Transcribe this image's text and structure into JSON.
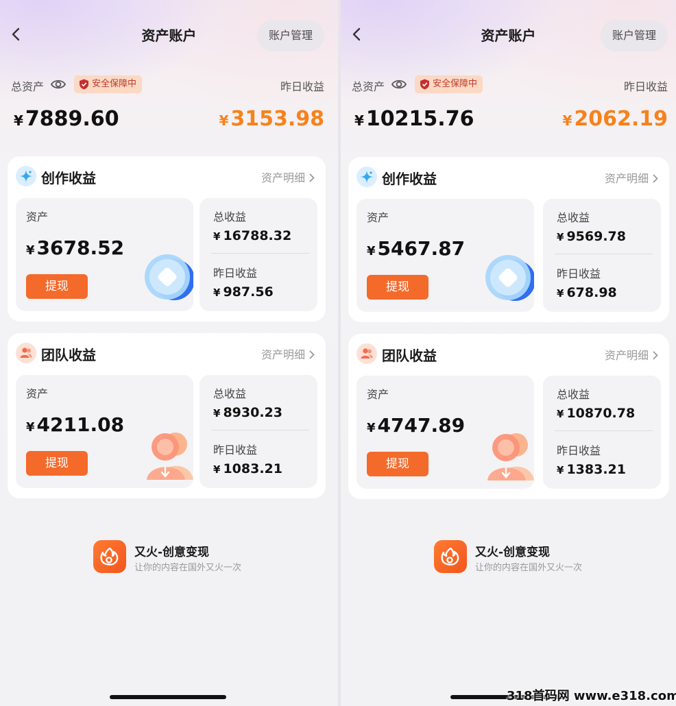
{
  "screens": [
    {
      "nav": {
        "title": "资产账户",
        "manage_label": "账户管理"
      },
      "summary": {
        "total_label": "总资产",
        "safe_badge": "安全保障中",
        "yesterday_label": "昨日收益",
        "currency": "¥",
        "total_amount": "7889.60",
        "yesterday_amount": "3153.98"
      },
      "cards": [
        {
          "title": "创作收益",
          "detail_link": "资产明细",
          "asset_label": "资产",
          "asset_amount": "3678.52",
          "withdraw_label": "提现",
          "total_income_label": "总收益",
          "total_income": "16788.32",
          "yesterday_income_label": "昨日收益",
          "yesterday_income": "987.56"
        },
        {
          "title": "团队收益",
          "detail_link": "资产明细",
          "asset_label": "资产",
          "asset_amount": "4211.08",
          "withdraw_label": "提现",
          "total_income_label": "总收益",
          "total_income": "8930.23",
          "yesterday_income_label": "昨日收益",
          "yesterday_income": "1083.21"
        }
      ],
      "brand": {
        "name": "又火-创意变现",
        "slogan": "让你的内容在国外又火一次"
      }
    },
    {
      "nav": {
        "title": "资产账户",
        "manage_label": "账户管理"
      },
      "summary": {
        "total_label": "总资产",
        "safe_badge": "安全保障中",
        "yesterday_label": "昨日收益",
        "currency": "¥",
        "total_amount": "10215.76",
        "yesterday_amount": "2062.19"
      },
      "cards": [
        {
          "title": "创作收益",
          "detail_link": "资产明细",
          "asset_label": "资产",
          "asset_amount": "5467.87",
          "withdraw_label": "提现",
          "total_income_label": "总收益",
          "total_income": "9569.78",
          "yesterday_income_label": "昨日收益",
          "yesterday_income": "678.98"
        },
        {
          "title": "团队收益",
          "detail_link": "资产明细",
          "asset_label": "资产",
          "asset_amount": "4747.89",
          "withdraw_label": "提现",
          "total_income_label": "总收益",
          "total_income": "10870.78",
          "yesterday_income_label": "昨日收益",
          "yesterday_income": "1383.21"
        }
      ],
      "brand": {
        "name": "又火-创意变现",
        "slogan": "让你的内容在国外又火一次"
      }
    }
  ],
  "watermark": "318首码网 www.e318.com",
  "icons": {
    "back": "chevron-left-icon",
    "eye": "eye-icon",
    "shield": "shield-icon",
    "sparkle": "sparkle-icon",
    "team": "team-icon",
    "chevron": "chevron-right-icon",
    "logo": "brand-logo-icon"
  },
  "colors": {
    "accent_orange": "#f7821b",
    "button_orange": "#f46a2b",
    "badge_bg": "#fbd9c4",
    "badge_text": "#c0392b"
  }
}
